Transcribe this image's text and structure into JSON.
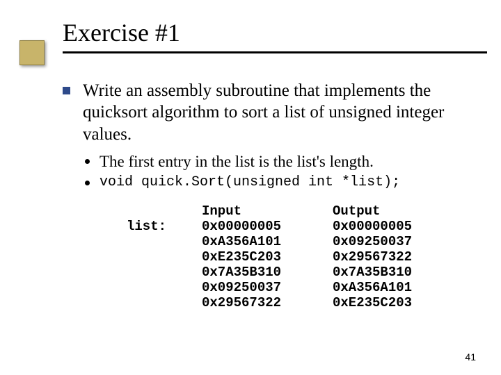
{
  "title": "Exercise #1",
  "main_bullet": "Write an assembly subroutine that implements the quicksort algorithm to sort a list of unsigned integer values.",
  "sub_bullets": {
    "a": "The first entry in the list is the list's length.",
    "b": "void quick.Sort(unsigned int *list);"
  },
  "table": {
    "label": "list:",
    "input_header": "Input",
    "output_header": "Output",
    "input": [
      "0x00000005",
      "0xA356A101",
      "0xE235C203",
      "0x7A35B310",
      "0x09250037",
      "0x29567322"
    ],
    "output": [
      "0x00000005",
      "0x09250037",
      "0x29567322",
      "0x7A35B310",
      "0xA356A101",
      "0xE235C203"
    ]
  },
  "page_number": "41"
}
